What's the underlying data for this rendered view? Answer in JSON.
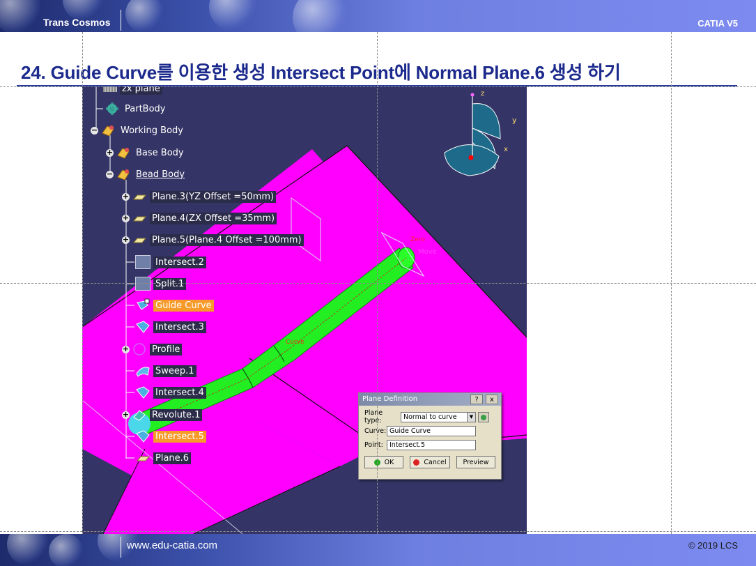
{
  "header": {
    "brand": "Trans Cosmos",
    "product": "CATIA V5"
  },
  "title": "24. Guide Curve를 이용한 생성 Intersect Point에 Normal Plane.6 생성 하기",
  "footer": {
    "website": "www.edu-catia.com",
    "copyright": "© 2019 LCS"
  },
  "tree": [
    {
      "label": "zx plane",
      "style": "dark"
    },
    {
      "label": "PartBody",
      "style": "plain"
    },
    {
      "label": "Working Body",
      "style": "plain"
    },
    {
      "label": "Base Body",
      "style": "plain"
    },
    {
      "label": "Bead Body",
      "style": "underline"
    },
    {
      "label": "Plane.3(YZ Offset =50mm)",
      "style": "dark"
    },
    {
      "label": "Plane.4(ZX Offset =35mm)",
      "style": "dark"
    },
    {
      "label": "Plane.5(Plane.4 Offset =100mm)",
      "style": "dark"
    },
    {
      "label": "Intersect.2",
      "style": "dark"
    },
    {
      "label": "Split.1",
      "style": "dark"
    },
    {
      "label": "Guide Curve",
      "style": "orange"
    },
    {
      "label": "Intersect.3",
      "style": "dark"
    },
    {
      "label": "Profile",
      "style": "dark"
    },
    {
      "label": "Sweep.1",
      "style": "dark"
    },
    {
      "label": "Intersect.4",
      "style": "dark"
    },
    {
      "label": "Revolute.1",
      "style": "dark"
    },
    {
      "label": "Intersect.5",
      "style": "orange"
    },
    {
      "label": "Plane.6",
      "style": "dark"
    }
  ],
  "viewport": {
    "curve_label": "Curve",
    "zero_label": "Zero",
    "move_label": "Move",
    "axis_x": "x",
    "axis_y": "y",
    "axis_z": "z",
    "colors": {
      "background": "#343466",
      "sheet": "#ff00ff",
      "sweep": "#22ee22"
    }
  },
  "dialog": {
    "title": "Plane Definition",
    "help": "?",
    "close": "x",
    "plane_type_label": "Plane type:",
    "plane_type_value": "Normal to curve",
    "curve_label": "Curve:",
    "curve_value": "Guide Curve",
    "point_label": "Point:",
    "point_value": "Intersect.5",
    "ok": "OK",
    "cancel": "Cancel",
    "preview": "Preview"
  }
}
